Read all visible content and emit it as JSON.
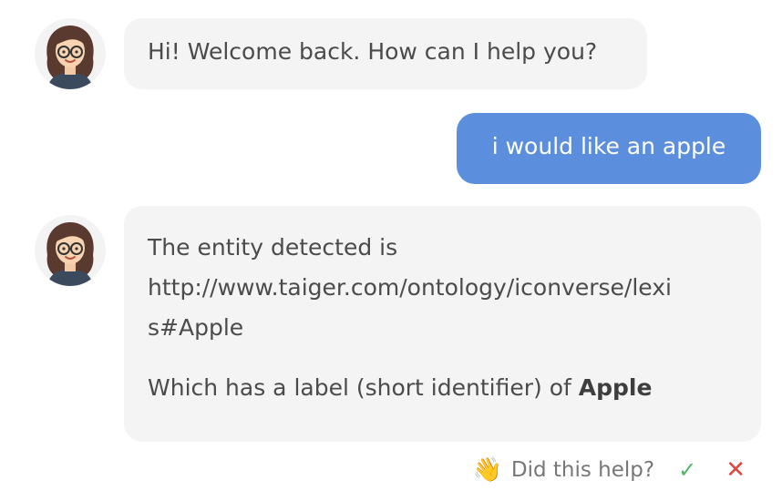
{
  "messages": [
    {
      "sender": "bot",
      "text": "Hi! Welcome back. How can I help you?"
    },
    {
      "sender": "user",
      "text": "i would like an apple"
    },
    {
      "sender": "bot",
      "lines": [
        "The entity detected is",
        "http://www.taiger.com/ontology/iconverse/lexi",
        "s#Apple"
      ],
      "label_prefix": "Which has a label (short identifier) of ",
      "label_value": "Apple"
    }
  ],
  "feedback": {
    "wave_icon": "👋",
    "prompt": "Did this help?",
    "yes_icon": "✓",
    "no_icon": "✕",
    "colors": {
      "yes": "#53b563",
      "no": "#e0453f"
    }
  },
  "colors": {
    "user_bubble": "#5b8fdd",
    "bot_bubble": "#f4f4f4"
  }
}
